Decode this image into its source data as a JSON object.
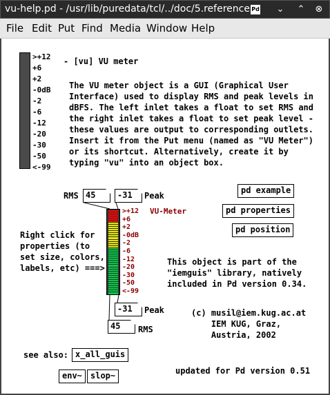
{
  "window": {
    "title": "vu-help.pd  - /usr/lib/puredata/tcl/../doc/5.reference",
    "logo_text": "Pd",
    "minimize_glyph": "⌄",
    "maximize_glyph": "⌃",
    "close_glyph": "⊗"
  },
  "menu": [
    "File",
    "Edit",
    "Put",
    "Find",
    "Media",
    "Window",
    "Help"
  ],
  "big_vu": {
    "scale": [
      ">+12",
      "+6",
      "+2",
      "-0dB",
      "-2",
      "-6",
      "-12",
      "-20",
      "-30",
      "-50",
      "<-99"
    ]
  },
  "header": {
    "title": "- [vu] VU meter"
  },
  "description": "The VU meter object is a GUI (Graphical User\nInterface) used to display RMS and peak levels in\ndBFS. The left inlet takes a float to set RMS and\nthe right inlet takes a float to set peak level -\nthese values are output to corresponding outlets.\nInsert it from the Put menu (named as \"VU Meter\")\nor its shortcut. Alternatively, create it by\ntyping \"vu\" into an object box.",
  "patch": {
    "rms_label": "RMS",
    "rms_in": "45",
    "peak_label": "Peak",
    "peak_in": "-31",
    "vu_label": "VU-Meter",
    "vu_scale": [
      ">+12",
      "+6",
      "+2",
      "-0dB",
      "-2",
      "-6",
      "-12",
      "-20",
      "-30",
      "-50",
      "<-99"
    ],
    "peak_out": "-31",
    "peak_out_label": "Peak",
    "rms_out": "45",
    "rms_out_label": "RMS",
    "rms_level_db": 45,
    "peak_level_db": -31,
    "colors": {
      "vu_red": "#ff0000",
      "vu_yellow": "#e8e800",
      "vu_green": "#00cc44",
      "vu_dark": "#333333",
      "vu_label": "#8b0000"
    }
  },
  "right_click_note": "Right click for\nproperties (to\nset size, colors,\nlabels, etc) ===>",
  "buttons": {
    "example": "pd example",
    "properties": "pd properties",
    "position": "pd position"
  },
  "library_note": "This object is part of the\n\"iemguis\" library, natively\nincluded in Pd version 0.34.",
  "credits": "(c) musil@iem.kug.ac.at\n    IEM KUG, Graz,\n    Austria, 2002",
  "see_also": {
    "label": "see also:",
    "items": [
      "x_all_guis",
      "env~",
      "slop~"
    ]
  },
  "updated": "updated for Pd version 0.51"
}
